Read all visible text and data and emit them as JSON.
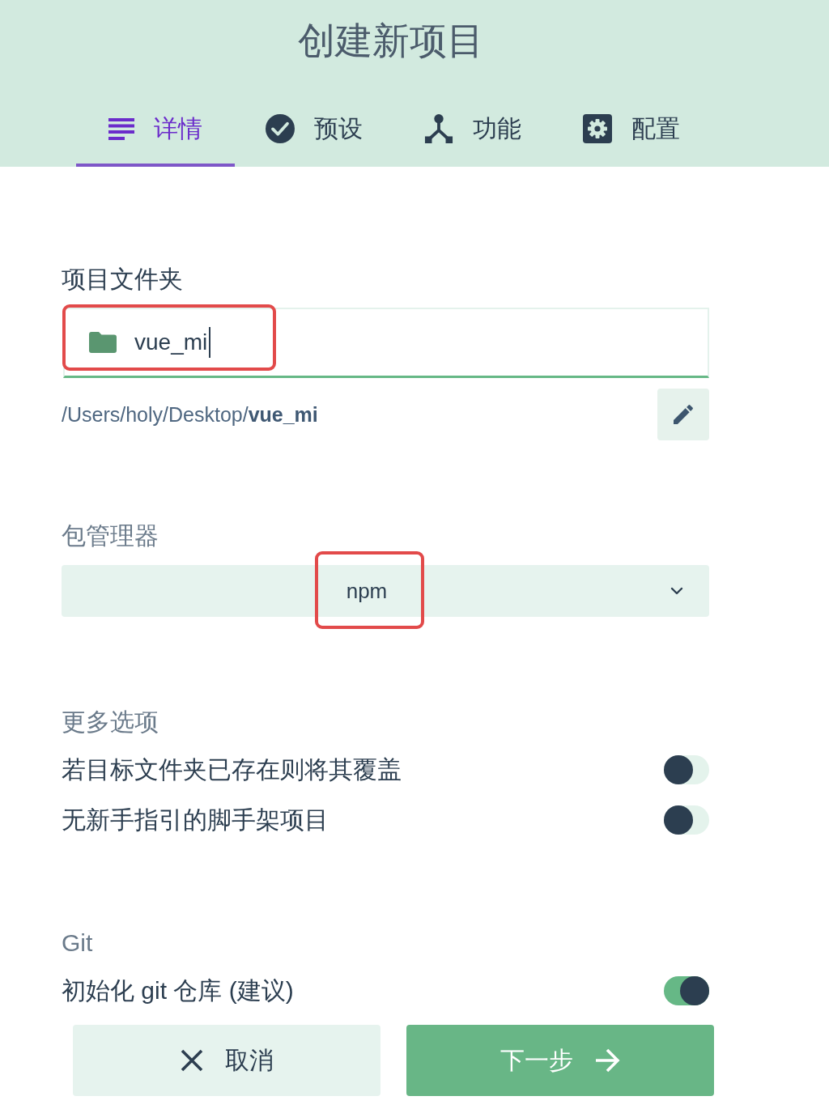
{
  "title": "创建新项目",
  "tabs": [
    {
      "label": "详情",
      "kind": "details",
      "selected": true
    },
    {
      "label": "预设",
      "kind": "preset",
      "selected": false
    },
    {
      "label": "功能",
      "kind": "features",
      "selected": false
    },
    {
      "label": "配置",
      "kind": "config",
      "selected": false
    }
  ],
  "project_folder": {
    "label": "项目文件夹",
    "value": "vue_mi",
    "focused": true,
    "highlighted": true,
    "path": "/Users/holy/Desktop/**vue_mi**"
  },
  "package_manager": {
    "label": "包管理器",
    "value": "npm",
    "highlighted": true
  },
  "more_options": {
    "label": "更多选项",
    "options": [
      {
        "label": "若目标文件夹已存在则将其覆盖",
        "on": false
      },
      {
        "label": "无新手指引的脚手架项目",
        "on": false
      }
    ]
  },
  "git": {
    "label": "Git",
    "options": [
      {
        "label": "初始化 git 仓库 (建议)",
        "on": true
      }
    ]
  },
  "buttons": [
    {
      "label": "取消",
      "kind": "cancel"
    },
    {
      "label": "下一步",
      "kind": "next"
    }
  ]
}
